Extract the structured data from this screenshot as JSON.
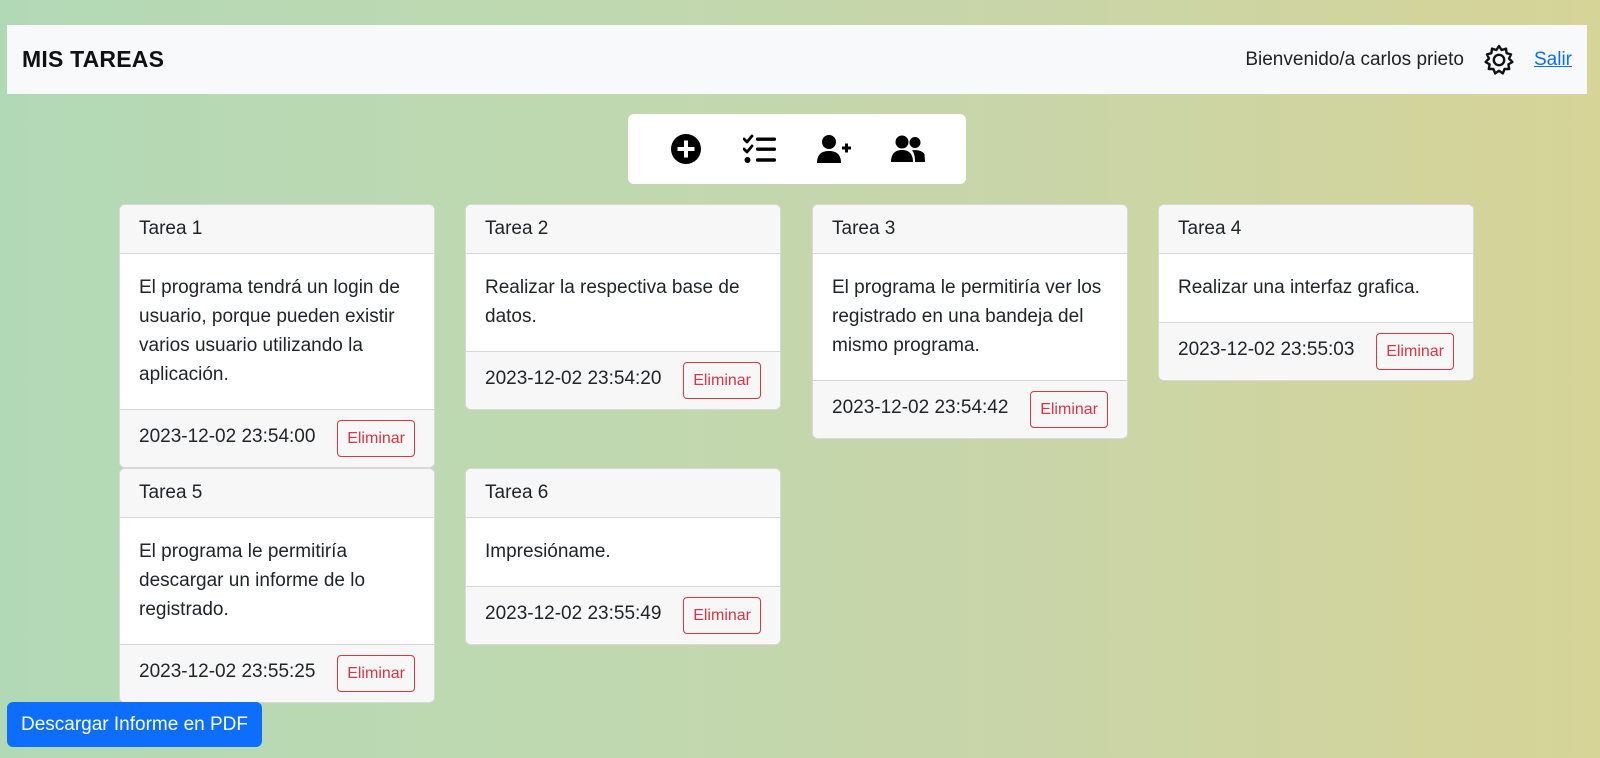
{
  "header": {
    "title": "MIS TAREAS",
    "welcome": "Bienvenido/a carlos prieto",
    "settings_icon": "gear-icon",
    "logout_label": "Salir"
  },
  "toolbar": {
    "items": [
      {
        "name": "add-task",
        "icon": "plus-circle-icon"
      },
      {
        "name": "task-list",
        "icon": "checklist-icon"
      },
      {
        "name": "add-user",
        "icon": "user-plus-icon"
      },
      {
        "name": "users",
        "icon": "users-icon"
      }
    ]
  },
  "tasks": [
    {
      "title": "Tarea 1",
      "description": "El programa tendrá un login de usuario, porque pueden existir varios usuario utilizando la aplicación.",
      "date": "2023-12-02 23:54:00",
      "delete_label": "Eliminar"
    },
    {
      "title": "Tarea 2",
      "description": "Realizar la respectiva base de datos.",
      "date": "2023-12-02 23:54:20",
      "delete_label": "Eliminar"
    },
    {
      "title": "Tarea 3",
      "description": "El programa le permitiría ver los registrado en una bandeja del mismo programa.",
      "date": "2023-12-02 23:54:42",
      "delete_label": "Eliminar"
    },
    {
      "title": "Tarea 4",
      "description": "Realizar una interfaz grafica.",
      "date": "2023-12-02 23:55:03",
      "delete_label": "Eliminar"
    },
    {
      "title": "Tarea 5",
      "description": "El programa le permitiría descargar un informe de lo registrado.",
      "date": "2023-12-02 23:55:25",
      "delete_label": "Eliminar"
    },
    {
      "title": "Tarea 6",
      "description": "Impresióname.",
      "date": "2023-12-02 23:55:49",
      "delete_label": "Eliminar"
    }
  ],
  "download_button": "Descargar Informe en PDF",
  "colors": {
    "primary": "#0d6efd",
    "danger": "#dc3545",
    "navbar_bg": "#f8f9fa"
  }
}
